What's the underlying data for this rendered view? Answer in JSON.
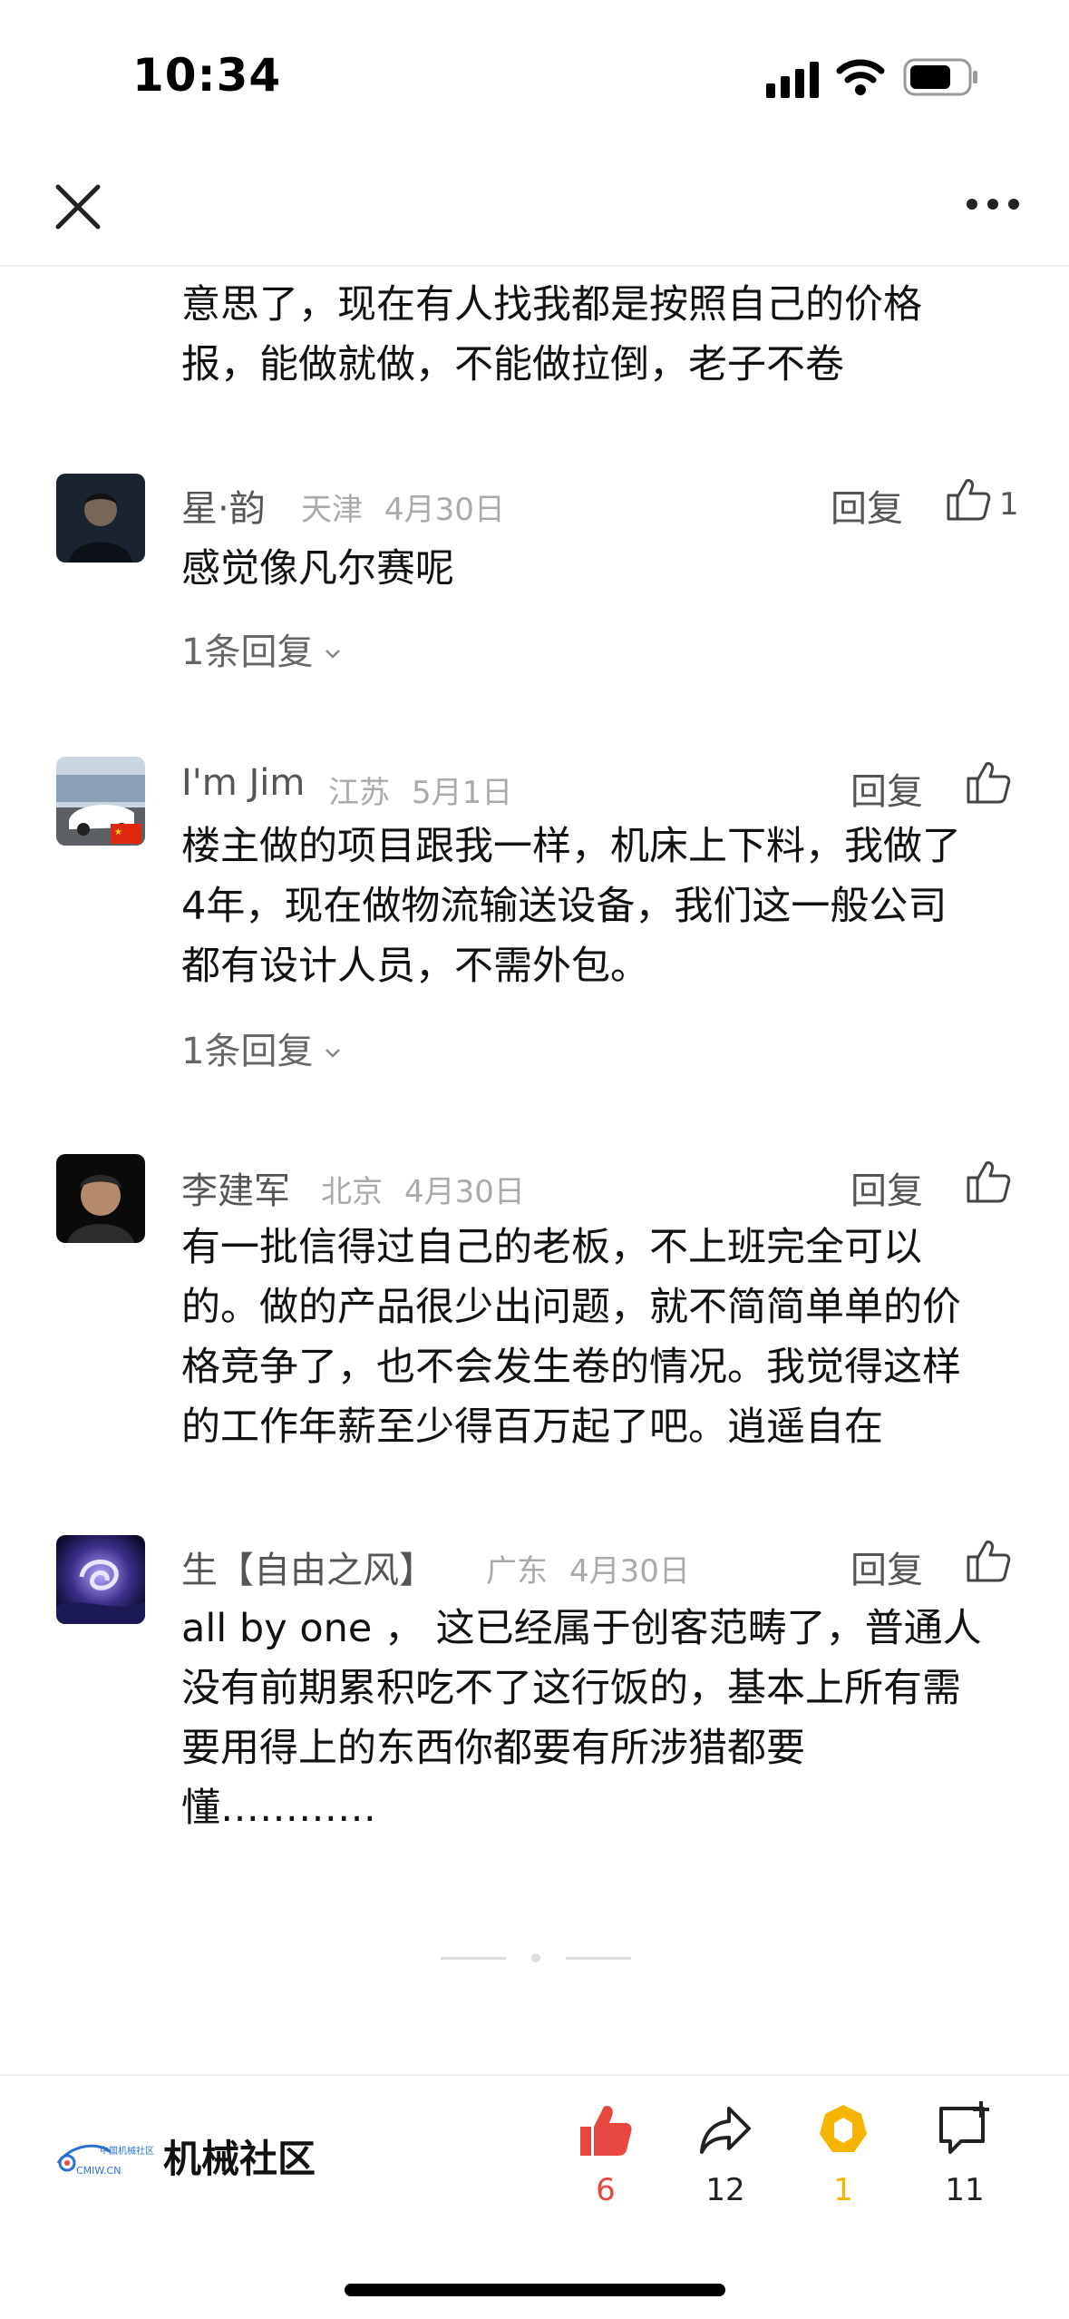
{
  "status_bar": {
    "time": "10:34"
  },
  "nav": {
    "close_icon": "close-icon",
    "more_icon": "more-icon"
  },
  "colors": {
    "like_active": "#e8473f",
    "gold": "#f4b400",
    "gray_text": "#999999"
  },
  "partial_comment": {
    "lines": [
      "意思了，现在有人找我都是按照自己的价格",
      "报，能做就做，不能做拉倒，老子不卷"
    ]
  },
  "comments": [
    {
      "username": "星·韵",
      "location": "天津",
      "date": "4月30日",
      "reply_label": "回复",
      "likes": "1",
      "lines": [
        "感觉像凡尔赛呢"
      ],
      "sub_replies": "1条回复"
    },
    {
      "username": "I'm Jim",
      "location": "江苏",
      "date": "5月1日",
      "reply_label": "回复",
      "lines": [
        "楼主做的项目跟我一样，机床上下料，我做了",
        "4年，现在做物流输送设备，我们这一般公司",
        "都有设计人员，不需外包。"
      ],
      "sub_replies": "1条回复"
    },
    {
      "username": "李建军",
      "location": "北京",
      "date": "4月30日",
      "reply_label": "回复",
      "lines": [
        "有一批信得过自己的老板，不上班完全可以",
        "的。做的产品很少出问题，就不简简单单的价",
        "格竞争了，也不会发生卷的情况。我觉得这样",
        "的工作年薪至少得百万起了吧。逍遥自在"
      ]
    },
    {
      "username": "生【自由之风】",
      "location": "广东",
      "date": "4月30日",
      "reply_label": "回复",
      "lines": [
        "all by one ， 这已经属于创客范畴了，普通人",
        "没有前期累积吃不了这行饭的，基本上所有需",
        "要用得上的东西你都要有所涉猎都要",
        "懂…………"
      ]
    }
  ],
  "bottom_bar": {
    "community_name": "机械社区",
    "logo_text": "中国机械社区",
    "logo_url_text": "CMIW.CN",
    "like_count": "6",
    "share_count": "12",
    "coin_count": "1",
    "comment_count": "11"
  }
}
